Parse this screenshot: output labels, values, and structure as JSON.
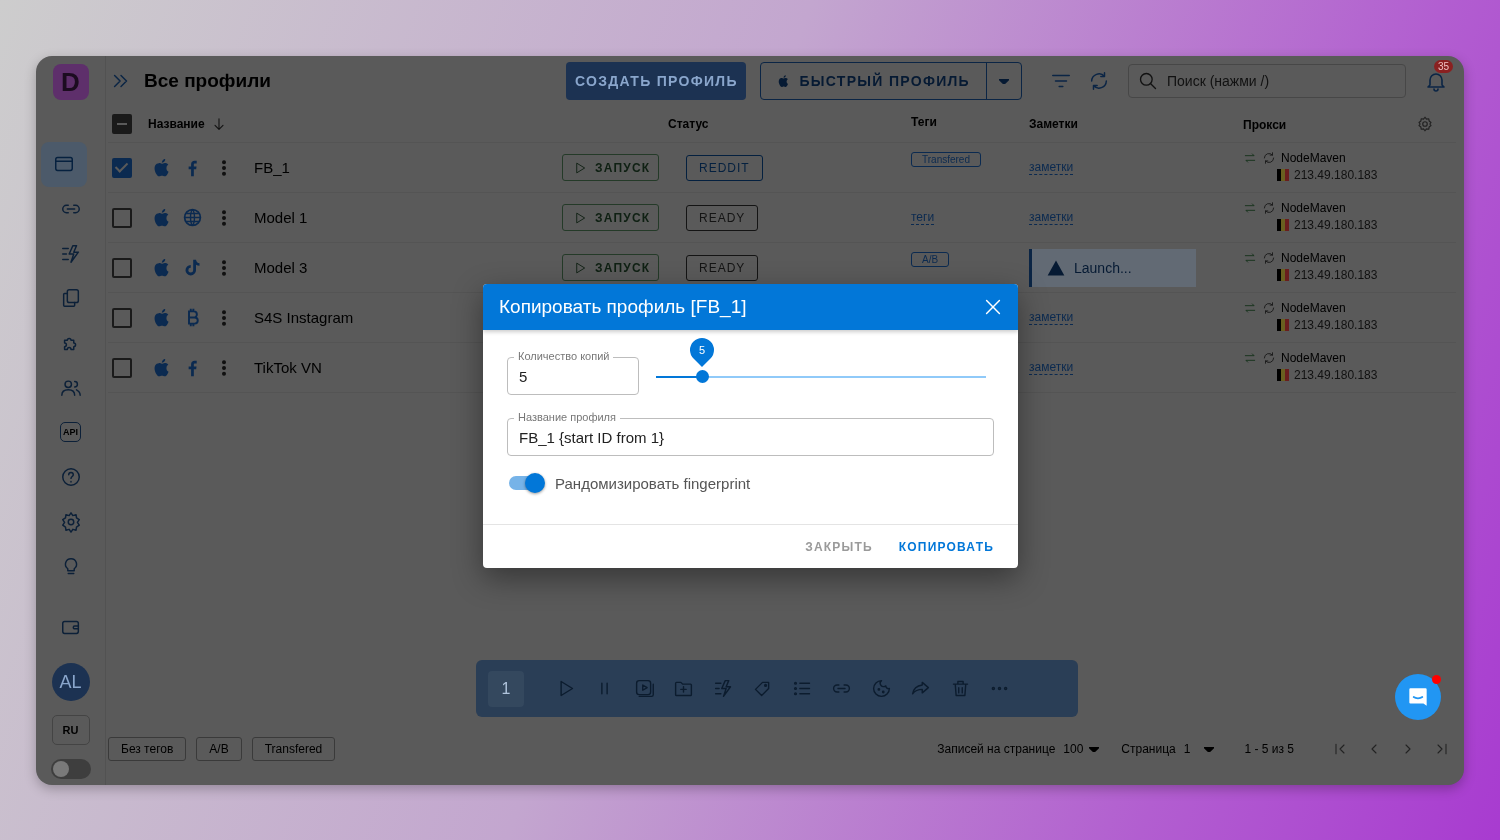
{
  "logo": {
    "text": "D"
  },
  "sidebar": {
    "items": [
      {
        "kind": "browser",
        "selected": true
      },
      {
        "kind": "link",
        "selected": false
      },
      {
        "kind": "bolt",
        "selected": false
      },
      {
        "kind": "copy",
        "selected": false
      },
      {
        "kind": "puzzle",
        "selected": false
      },
      {
        "kind": "people",
        "selected": false
      },
      {
        "kind": "api",
        "label": "API",
        "selected": false
      },
      {
        "kind": "help",
        "selected": false
      },
      {
        "kind": "settings",
        "selected": false
      },
      {
        "kind": "bulb",
        "selected": false
      }
    ],
    "avatar": "AL",
    "language": "RU",
    "theme_toggle": {
      "on": false
    }
  },
  "header": {
    "title": "Все профили",
    "create_button": "СОЗДАТЬ ПРОФИЛЬ",
    "quick_button": "БЫСТРЫЙ ПРОФИЛЬ",
    "search": {
      "placeholder": "Поиск (нажми /)"
    },
    "notifications": "35"
  },
  "table": {
    "select_all": {
      "indeterminate": true
    },
    "columns": [
      "Название",
      "Статус",
      "Теги",
      "Заметки",
      "Прокси"
    ],
    "rows": [
      {
        "checked": true,
        "kind": "facebook",
        "name": "FB_1",
        "launch": "ЗАПУСК",
        "status": {
          "text": "REDDIT",
          "color": "#04203f"
        },
        "tag": {
          "kind": "chip",
          "text": "Transfered"
        },
        "notes": {
          "kind": "text",
          "text": "заметки"
        },
        "proxy": {
          "name": "NodeMaven",
          "ip": "213.49.180.183"
        }
      },
      {
        "checked": false,
        "kind": "globe",
        "name": "Model 1",
        "launch": "ЗАПУСК",
        "status": {
          "text": "READY",
          "color": "#141414"
        },
        "tag": {
          "kind": "placeholder",
          "text": "теги"
        },
        "notes": {
          "kind": "text",
          "text": "заметки"
        },
        "proxy": {
          "name": "NodeMaven",
          "ip": "213.49.180.183"
        }
      },
      {
        "checked": false,
        "kind": "tiktok",
        "name": "Model 3",
        "launch": "ЗАПУСК",
        "status": {
          "text": "READY",
          "color": "#141414"
        },
        "tag": {
          "kind": "chip",
          "text": "A/B"
        },
        "notes": {
          "kind": "launching",
          "text": "Launch..."
        },
        "proxy": {
          "name": "NodeMaven",
          "ip": "213.49.180.183"
        }
      },
      {
        "checked": false,
        "kind": "bitcoin",
        "name": "S4S Instagram",
        "notes": {
          "kind": "text",
          "text": "заметки"
        },
        "proxy": {
          "name": "NodeMaven",
          "ip": "213.49.180.183"
        }
      },
      {
        "checked": false,
        "kind": "facebook",
        "name": "TikTok VN",
        "notes": {
          "kind": "text",
          "text": "заметки"
        },
        "proxy": {
          "name": "NodeMaven",
          "ip": "213.49.180.183"
        }
      }
    ]
  },
  "action_bar": {
    "count": "1",
    "tools": [
      {
        "kind": "play"
      },
      {
        "kind": "pause"
      },
      {
        "kind": "video"
      },
      {
        "kind": "folder-plus"
      },
      {
        "kind": "bolt"
      },
      {
        "kind": "tag"
      },
      {
        "kind": "list"
      },
      {
        "kind": "link"
      },
      {
        "kind": "cookie"
      },
      {
        "kind": "share"
      },
      {
        "kind": "trash"
      },
      {
        "kind": "more"
      }
    ]
  },
  "footer": {
    "tag_filters": [
      "Без тегов",
      "A/B",
      "Transfered"
    ],
    "per_page_label": "Записей на странице",
    "per_page": "100",
    "page_label": "Страница",
    "page": "1",
    "range": "1 - 5 из 5",
    "nav": [
      {
        "kind": "first"
      },
      {
        "kind": "prev"
      },
      {
        "kind": "next"
      },
      {
        "kind": "last"
      }
    ]
  },
  "chat": {
    "unread": true
  },
  "modal": {
    "title": "Копировать профиль [FB_1]",
    "copies": {
      "label": "Количество копий",
      "value": "5"
    },
    "slider": {
      "level": 0.14,
      "tooltip": "5"
    },
    "name_field": {
      "label": "Название профиля",
      "value": "FB_1 {start ID from 1}"
    },
    "randomize": {
      "on": true,
      "label": "Рандомизировать fingerprint"
    },
    "buttons": [
      {
        "kind": "secondary",
        "text": "ЗАКРЫТЬ"
      },
      {
        "kind": "primary",
        "text": "КОПИРОВАТЬ"
      }
    ]
  }
}
